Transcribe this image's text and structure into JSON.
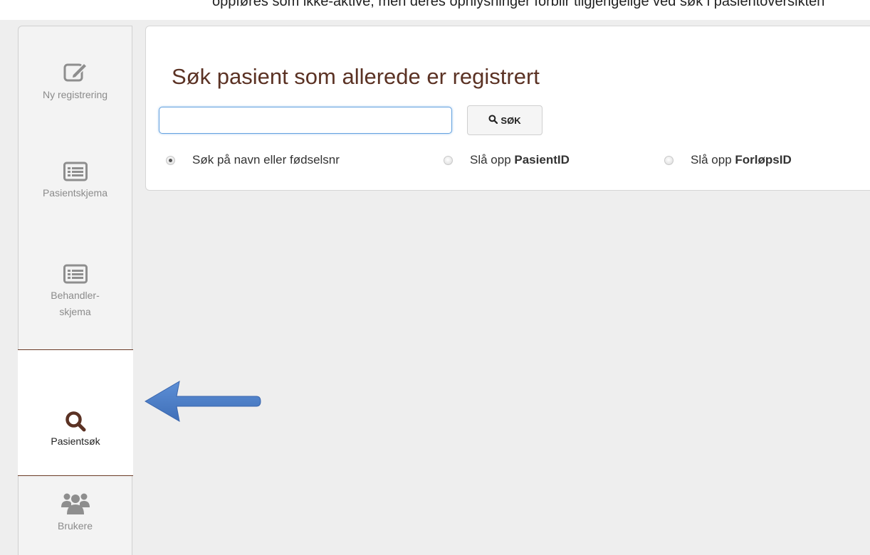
{
  "top_clip_text": "oppføres som ikke-aktive, men deres opnlysninger forblir tilgjengelige ved søk i pasientoversikten",
  "sidebar": {
    "items": [
      {
        "label": "Ny registrering",
        "icon": "edit-icon"
      },
      {
        "label": "Pasientskjema",
        "icon": "list-icon"
      },
      {
        "label": "Behandler-\nskjema",
        "icon": "list-icon"
      },
      {
        "label": "Pasientsøk",
        "icon": "search-icon",
        "active": true
      },
      {
        "label": "Brukere",
        "icon": "users-icon"
      }
    ]
  },
  "main": {
    "title": "Søk pasient som allerede er registrert",
    "search": {
      "value": "",
      "placeholder": "",
      "button_label": "SØK"
    },
    "radios": [
      {
        "prefix": "Søk på navn eller fødselsnr",
        "bold": "",
        "checked": true
      },
      {
        "prefix": "Slå opp ",
        "bold": "PasientID",
        "checked": false
      },
      {
        "prefix": "Slå opp ",
        "bold": "ForløpsID",
        "checked": false
      }
    ]
  },
  "colors": {
    "accent_brown": "#5b3224",
    "active_border": "#6a3a26",
    "arrow_blue": "#4f7fc8",
    "icon_gray": "#8e8e8e"
  }
}
